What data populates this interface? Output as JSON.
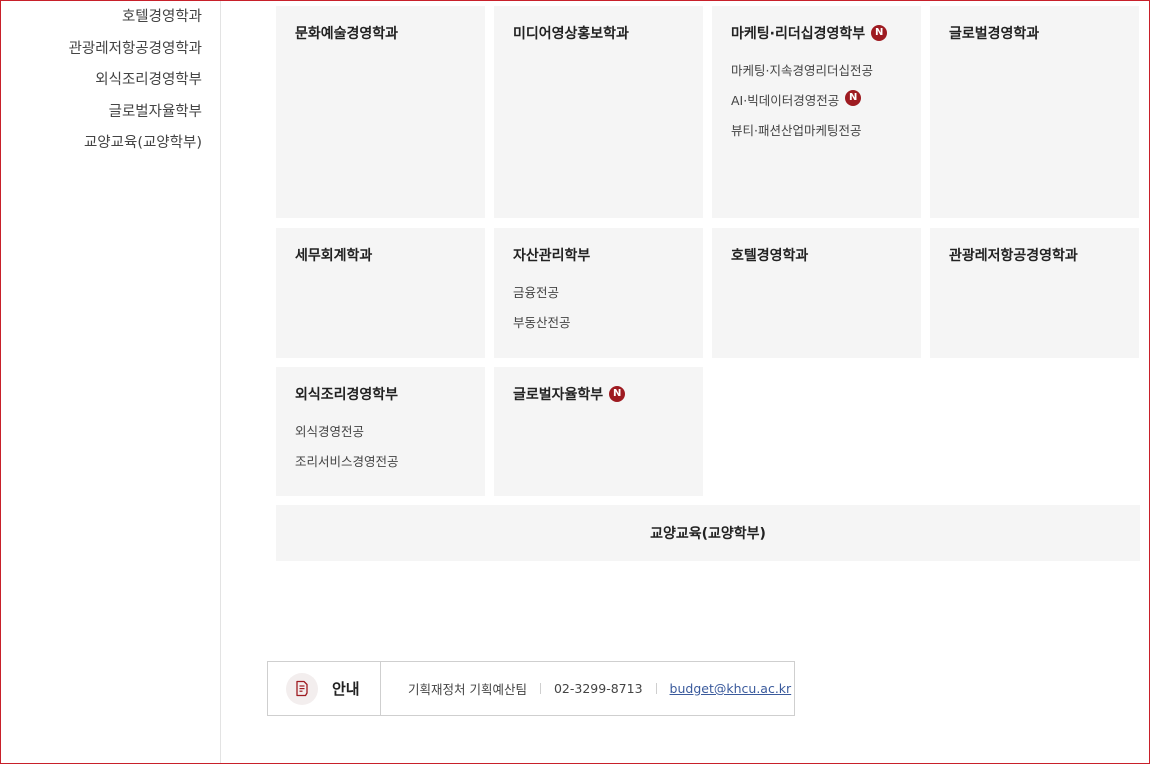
{
  "sidebar": {
    "items": [
      {
        "label": "호텔경영학과"
      },
      {
        "label": "관광레저항공경영학과"
      },
      {
        "label": "외식조리경영학부"
      },
      {
        "label": "글로벌자율학부"
      },
      {
        "label": "교양교육(교양학부)"
      }
    ]
  },
  "cards": [
    {
      "title": "문화예술경영학과",
      "badge": "",
      "subs": []
    },
    {
      "title": "미디어영상홍보학과",
      "badge": "",
      "subs": []
    },
    {
      "title": "마케팅·리더십경영학부",
      "badge": "N",
      "subs": [
        {
          "label": "마케팅·지속경영리더십전공",
          "badge": ""
        },
        {
          "label": "AI·빅데이터경영전공",
          "badge": "N"
        },
        {
          "label": "뷰티·패션산업마케팅전공",
          "badge": ""
        }
      ]
    },
    {
      "title": "글로벌경영학과",
      "badge": "",
      "subs": []
    },
    {
      "title": "세무회계학과",
      "badge": "",
      "subs": []
    },
    {
      "title": "자산관리학부",
      "badge": "",
      "subs": [
        {
          "label": "금융전공",
          "badge": ""
        },
        {
          "label": "부동산전공",
          "badge": ""
        }
      ]
    },
    {
      "title": "호텔경영학과",
      "badge": "",
      "subs": []
    },
    {
      "title": "관광레저항공경영학과",
      "badge": "",
      "subs": []
    },
    {
      "title": "외식조리경영학부",
      "badge": "",
      "subs": [
        {
          "label": "외식경영전공",
          "badge": ""
        },
        {
          "label": "조리서비스경영전공",
          "badge": ""
        }
      ]
    },
    {
      "title": "글로벌자율학부",
      "badge": "N",
      "subs": []
    }
  ],
  "wide_card": {
    "title": "교양교육(교양학부)"
  },
  "info": {
    "label": "안내",
    "department": "기획재정처 기획예산팀",
    "phone": "02-3299-8713",
    "email": "budget@khcu.ac.kr"
  },
  "colors": {
    "accent": "#9e1b21",
    "card_bg": "#f5f5f5",
    "frame": "#c8202a"
  }
}
